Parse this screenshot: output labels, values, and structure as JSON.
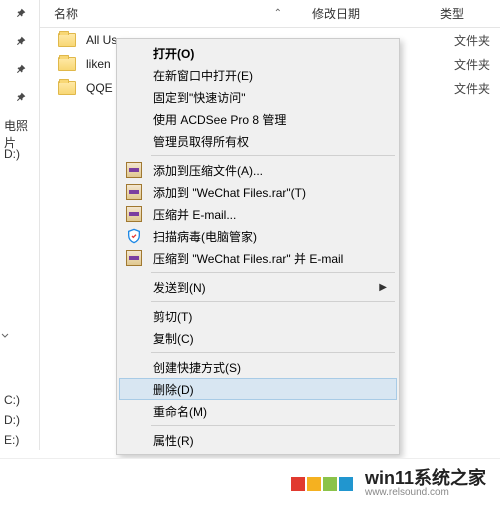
{
  "table": {
    "headers": {
      "name": "名称",
      "date": "修改日期",
      "type": "类型"
    }
  },
  "files": [
    {
      "name": "All Us",
      "date": "",
      "type": "文件夹"
    },
    {
      "name": "liken",
      "date": "",
      "type": "文件夹"
    },
    {
      "name": "QQE",
      "date": "",
      "type": "文件夹"
    }
  ],
  "left": {
    "photos": "电照片",
    "drives": [
      "D:)",
      "C:)",
      "D:)",
      "E:)"
    ]
  },
  "menu": {
    "open": "打开(O)",
    "open_new_window": "在新窗口中打开(E)",
    "pin_quick_access": "固定到\"快速访问\"",
    "acdsee": "使用 ACDSee Pro 8 管理",
    "admin_own": "管理员取得所有权",
    "add_archive": "添加到压缩文件(A)...",
    "add_wechat_rar": "添加到 \"WeChat Files.rar\"(T)",
    "compress_email": "压缩并 E-mail...",
    "scan_virus": "扫描病毒(电脑管家)",
    "compress_to_email": "压缩到 \"WeChat Files.rar\" 并 E-mail",
    "send_to": "发送到(N)",
    "cut": "剪切(T)",
    "copy": "复制(C)",
    "create_shortcut": "创建快捷方式(S)",
    "delete": "删除(D)",
    "rename": "重命名(M)",
    "properties": "属性(R)"
  },
  "watermark": {
    "main": "win11系统之家",
    "sub": "www.relsound.com"
  },
  "colors": {
    "wm_red": "#e13a2f",
    "wm_yellow": "#f5b120",
    "wm_green": "#8bc34a",
    "wm_blue": "#2196cf"
  }
}
